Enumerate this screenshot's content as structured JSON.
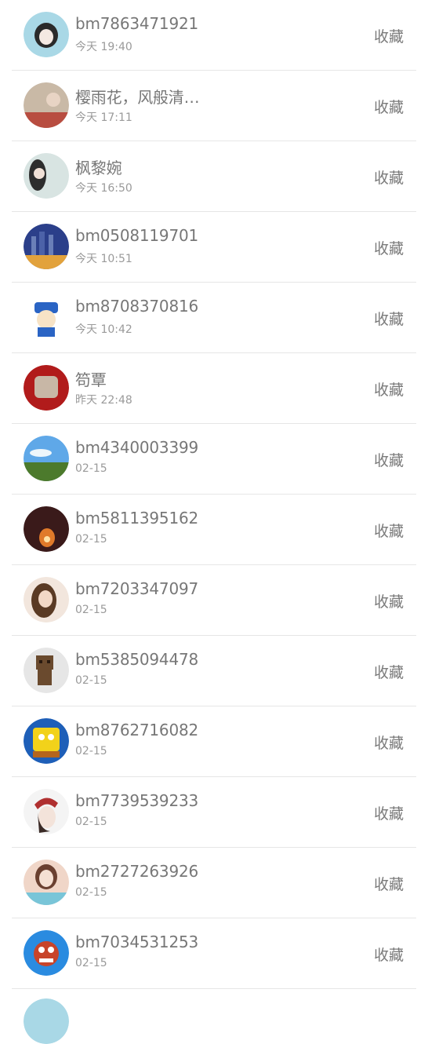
{
  "contacts": [
    {
      "name": "bm7863471921",
      "time": "今天 19:40",
      "action": "收藏",
      "colors": [
        "#a9d8e6",
        "#2a2a2a"
      ]
    },
    {
      "name": "樱雨花，风般清…",
      "time": "今天 17:11",
      "action": "收藏",
      "colors": [
        "#c9b9a6",
        "#b84d40"
      ]
    },
    {
      "name": "枫黎婉",
      "time": "今天 16:50",
      "action": "收藏",
      "colors": [
        "#d8e4e2",
        "#2d2d2d"
      ]
    },
    {
      "name": "bm0508119701",
      "time": "今天 10:51",
      "action": "收藏",
      "colors": [
        "#2b3f8a",
        "#e2a23c"
      ]
    },
    {
      "name": "bm8708370816",
      "time": "今天 10:42",
      "action": "收藏",
      "colors": [
        "#ffffff",
        "#2a64c4"
      ]
    },
    {
      "name": "笱覃",
      "time": "昨天 22:48",
      "action": "收藏",
      "colors": [
        "#b11b1b",
        "#c8b7a6"
      ]
    },
    {
      "name": "bm4340003399",
      "time": "02-15",
      "action": "收藏",
      "colors": [
        "#5fa8e8",
        "#4c7a2c"
      ]
    },
    {
      "name": "bm5811395162",
      "time": "02-15",
      "action": "收藏",
      "colors": [
        "#3a1a1a",
        "#e07a2a"
      ]
    },
    {
      "name": "bm7203347097",
      "time": "02-15",
      "action": "收藏",
      "colors": [
        "#f2e6dd",
        "#5a3a24"
      ]
    },
    {
      "name": "bm5385094478",
      "time": "02-15",
      "action": "收藏",
      "colors": [
        "#e6e6e6",
        "#6a4a2e"
      ]
    },
    {
      "name": "bm8762716082",
      "time": "02-15",
      "action": "收藏",
      "colors": [
        "#1e5fb8",
        "#f2d21a"
      ]
    },
    {
      "name": "bm7739539233",
      "time": "02-15",
      "action": "收藏",
      "colors": [
        "#f4f4f4",
        "#b03030"
      ]
    },
    {
      "name": "bm2727263926",
      "time": "02-15",
      "action": "收藏",
      "colors": [
        "#f0d6c8",
        "#79c5d8"
      ]
    },
    {
      "name": "bm7034531253",
      "time": "02-15",
      "action": "收藏",
      "colors": [
        "#2a8be0",
        "#c8442a"
      ]
    }
  ],
  "partial_avatar_color": "#a9d8e6"
}
